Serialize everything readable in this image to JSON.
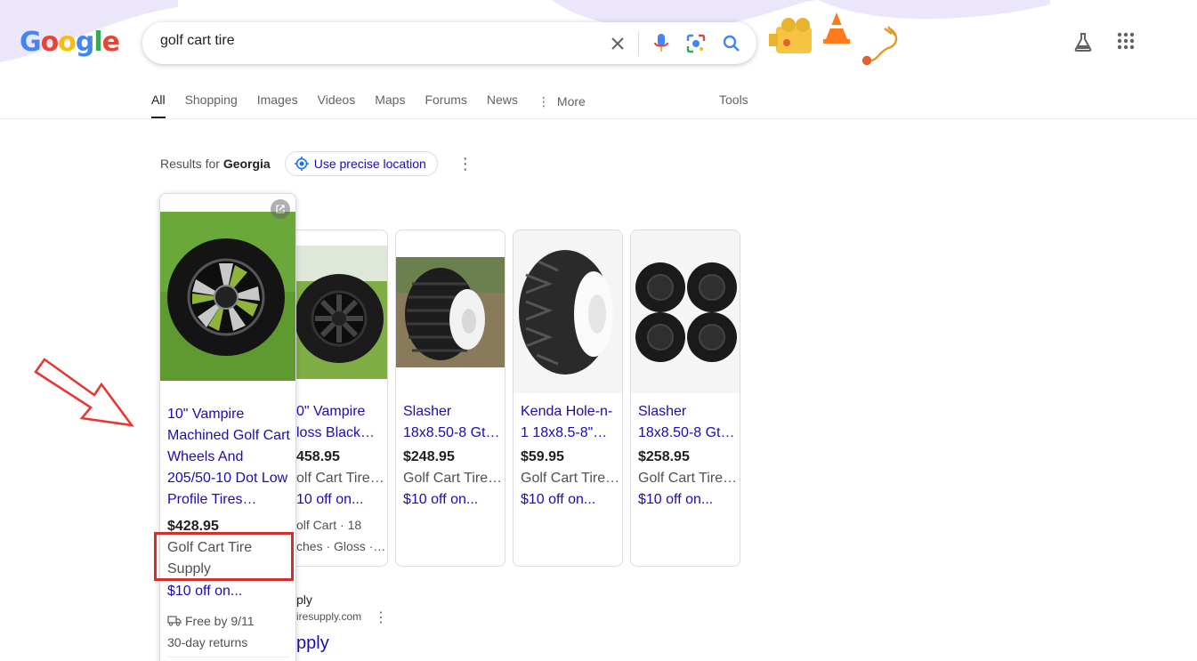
{
  "logo": {
    "letters": [
      "G",
      "o",
      "o",
      "g",
      "l",
      "e"
    ],
    "colors": [
      "#4285f4",
      "#ea4335",
      "#fbbc05",
      "#4285f4",
      "#34a853",
      "#ea4335"
    ]
  },
  "search": {
    "query": "golf cart tire"
  },
  "tabs": [
    {
      "label": "All",
      "active": true
    },
    {
      "label": "Shopping"
    },
    {
      "label": "Images"
    },
    {
      "label": "Videos"
    },
    {
      "label": "Maps"
    },
    {
      "label": "Forums"
    },
    {
      "label": "News"
    },
    {
      "label": "More"
    }
  ],
  "tools_label": "Tools",
  "location": {
    "prefix": "Results for",
    "place": "Georgia",
    "button": "Use precise location"
  },
  "featured": {
    "title": "10\" Vampire Machined Golf Cart Wheels And 205/50-10 Dot Low Profile Tires…",
    "price": "$428.95",
    "seller": "Golf Cart Tire Supply",
    "promo": "$10 off on...",
    "shipping": "Free by 9/11",
    "returns": "30-day returns"
  },
  "cards": [
    {
      "title1": "0\" Vampire",
      "title2": "loss Black…",
      "price": "458.95",
      "seller": "olf Cart Tire…",
      "promo": "10 off on...",
      "meta1": "olf Cart · 18",
      "meta2": "ches · Gloss ·…"
    },
    {
      "title1": "Slasher",
      "title2": "18x8.50-8 Gt…",
      "price": "$248.95",
      "seller": "Golf Cart Tire…",
      "promo": "$10 off on..."
    },
    {
      "title1": "Kenda Hole-n-",
      "title2": "1 18x8.5-8\"…",
      "price": "$59.95",
      "seller": "Golf Cart Tire…",
      "promo": "$10 off on..."
    },
    {
      "title1": "Slasher",
      "title2": "18x8.50-8 Gt…",
      "price": "$258.95",
      "seller": "Golf Cart Tire…",
      "promo": "$10 off on..."
    }
  ],
  "result": {
    "site": "ply",
    "url": "iresupply.com",
    "title": "pply"
  },
  "colors": {
    "link": "#1a0dab",
    "highlight": "#d32f2f",
    "arrow": "#e53935",
    "doodle_wave": "#ece6fb"
  }
}
